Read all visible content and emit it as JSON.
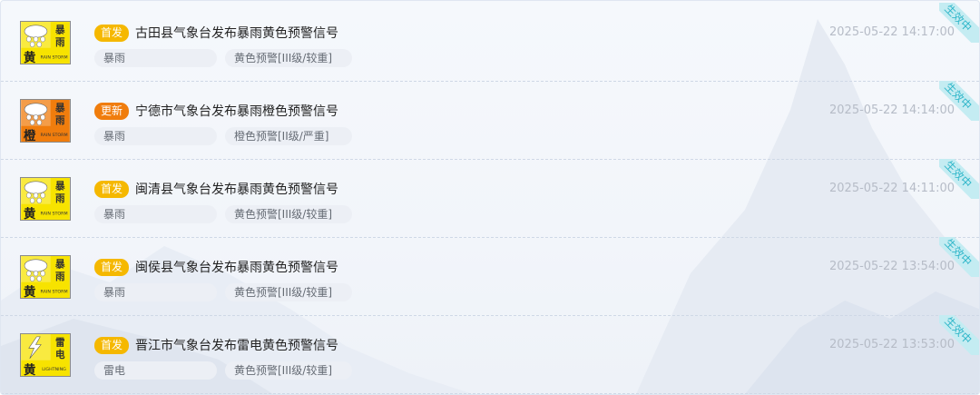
{
  "colors": {
    "first_tag": "#f5b800",
    "update_tag": "#f07d0d",
    "ribbon_bg": "#c4ecf2",
    "ribbon_text": "#2fb6c9",
    "yellow_signal": "#f7e300",
    "orange_signal": "#f07d0d"
  },
  "warnings": [
    {
      "tag": "首发",
      "tag_kind": "first",
      "title": "古田县气象台发布暴雨黄色预警信号",
      "time": "2025-05-22 14:17:00",
      "type": "暴雨",
      "level": "黄色预警[III级/较重]",
      "status": "生效中",
      "icon": {
        "name": "rainstorm-yellow-icon",
        "line1": "暴",
        "line2": "雨",
        "color_char": "黄",
        "en": "RAIN STORM",
        "color": "#f7e300"
      }
    },
    {
      "tag": "更新",
      "tag_kind": "update",
      "title": "宁德市气象台发布暴雨橙色预警信号",
      "time": "2025-05-22 14:14:00",
      "type": "暴雨",
      "level": "橙色预警[II级/严重]",
      "status": "生效中",
      "icon": {
        "name": "rainstorm-orange-icon",
        "line1": "暴",
        "line2": "雨",
        "color_char": "橙",
        "en": "RAIN STORM",
        "color": "#f07d0d"
      }
    },
    {
      "tag": "首发",
      "tag_kind": "first",
      "title": "闽清县气象台发布暴雨黄色预警信号",
      "time": "2025-05-22 14:11:00",
      "type": "暴雨",
      "level": "黄色预警[III级/较重]",
      "status": "生效中",
      "icon": {
        "name": "rainstorm-yellow-icon",
        "line1": "暴",
        "line2": "雨",
        "color_char": "黄",
        "en": "RAIN STORM",
        "color": "#f7e300"
      }
    },
    {
      "tag": "首发",
      "tag_kind": "first",
      "title": "闽侯县气象台发布暴雨黄色预警信号",
      "time": "2025-05-22 13:54:00",
      "type": "暴雨",
      "level": "黄色预警[III级/较重]",
      "status": "生效中",
      "icon": {
        "name": "rainstorm-yellow-icon",
        "line1": "暴",
        "line2": "雨",
        "color_char": "黄",
        "en": "RAIN STORM",
        "color": "#f7e300"
      }
    },
    {
      "tag": "首发",
      "tag_kind": "first",
      "title": "晋江市气象台发布雷电黄色预警信号",
      "time": "2025-05-22 13:53:00",
      "type": "雷电",
      "level": "黄色预警[III级/较重]",
      "status": "生效中",
      "icon": {
        "name": "lightning-yellow-icon",
        "line1": "雷",
        "line2": "电",
        "color_char": "黄",
        "en": "LIGHTNING",
        "color": "#f7e300"
      }
    }
  ]
}
